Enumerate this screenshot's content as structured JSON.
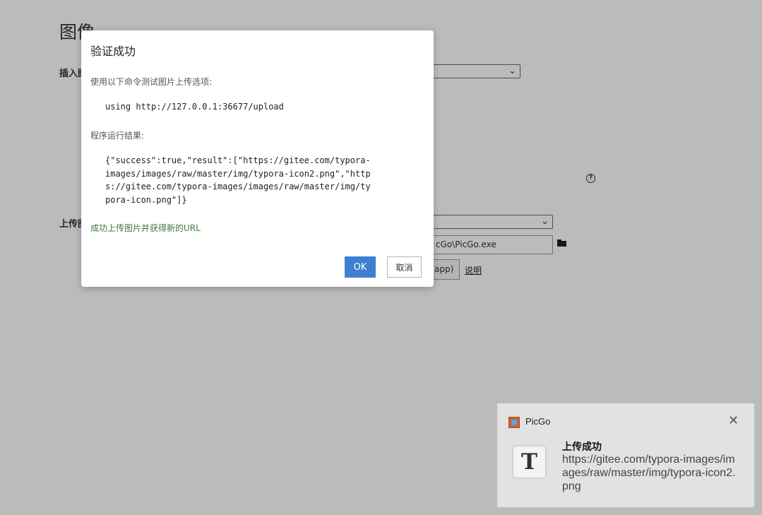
{
  "background": {
    "section_title": "图像",
    "insert_label": "插入图",
    "upload_label": "上传图",
    "path_value": "cGo\\PicGo.exe",
    "app_button": "app)",
    "help_link": "说明",
    "help_icon": "?"
  },
  "dialog": {
    "title": "验证成功",
    "instruction": "使用以下命令测试图片上传选项:",
    "command": "using http://127.0.0.1:36677/upload",
    "result_label": "程序运行结果:",
    "result_text": "{\"success\":true,\"result\":[\"https://gitee.com/typora-images/images/raw/master/img/typora-icon2.png\",\"https://gitee.com/typora-images/images/raw/master/img/typora-icon.png\"]}",
    "success_message": "成功上传图片并获得新的URL",
    "ok_label": "OK",
    "cancel_label": "取消"
  },
  "toast": {
    "app_name": "PicGo",
    "app_icon": "picgo-app-icon",
    "close_glyph": "✕",
    "image_glyph": "T",
    "title": "上传成功",
    "body": "https://gitee.com/typora-images/images/raw/master/img/typora-icon2.png"
  },
  "colors": {
    "primary_button": "#3f7fd1",
    "success_text": "#3f7a3a",
    "overlay": "rgba(0,0,0,0.265)"
  }
}
